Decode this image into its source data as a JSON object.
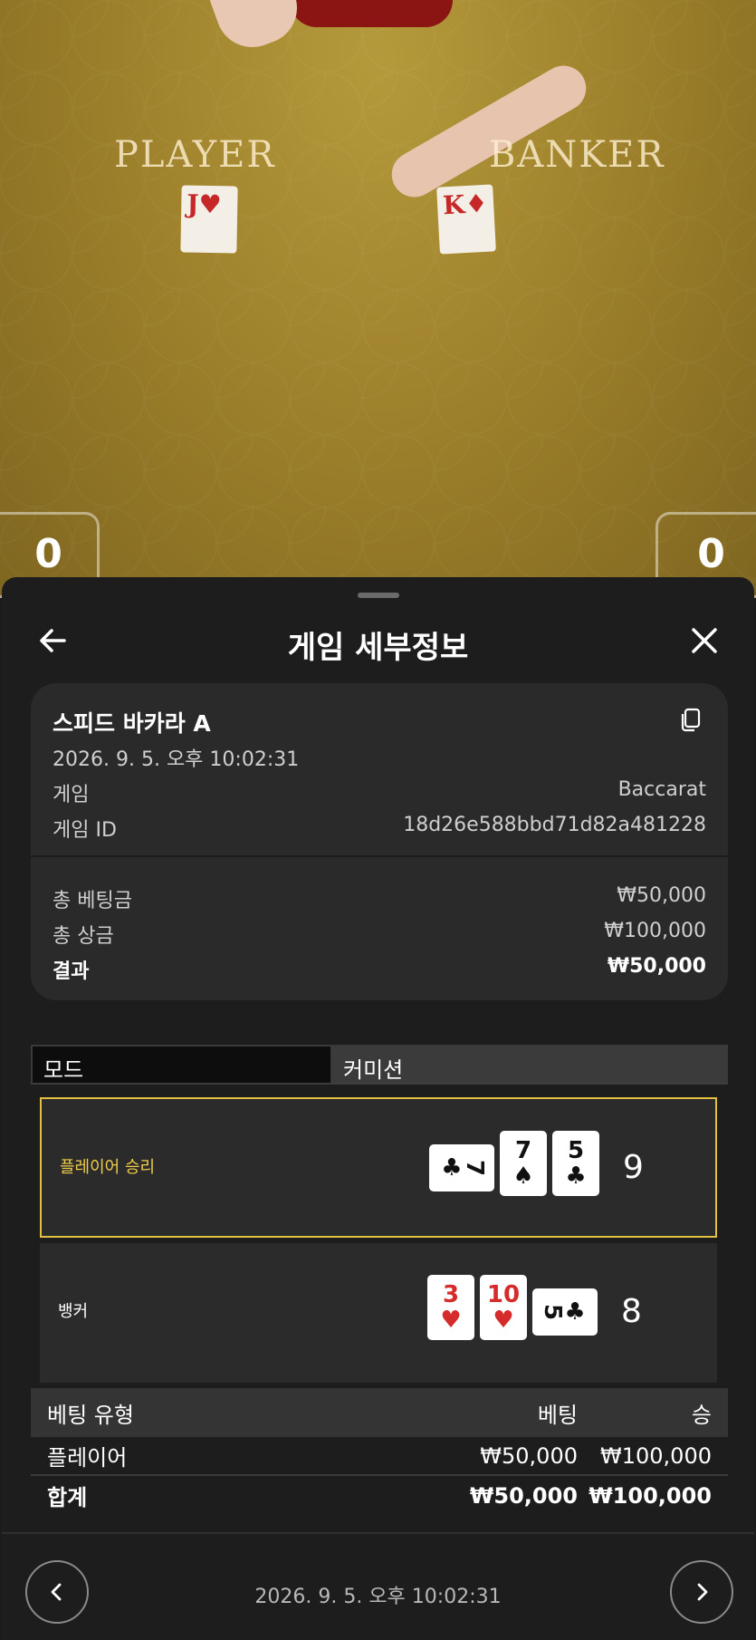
{
  "table_view": {
    "player_label": "PLAYER",
    "banker_label": "BANKER",
    "player_card": "J♥",
    "banker_card": "K♦",
    "player_score": "0",
    "banker_score": "0"
  },
  "header": {
    "title": "게임 세부정보",
    "back_icon": "arrow-left-icon",
    "close_icon": "close-icon"
  },
  "summary": {
    "table_name": "스피드 바카라 A",
    "timestamp": "2026. 9. 5. 오후 10:02:31",
    "game_label": "게임",
    "game_value": "Baccarat",
    "game_id_label": "게임 ID",
    "game_id_value": "18d26e588bbd71d82a481228",
    "total_bet_label": "총 베팅금",
    "total_bet_value": "₩50,000",
    "total_win_label": "총 상금",
    "total_win_value": "₩100,000",
    "result_label": "결과",
    "result_value": "₩50,000"
  },
  "tabs": {
    "mode": "모드",
    "commission": "커미션"
  },
  "hands": {
    "player": {
      "label": "플레이어 승리",
      "cards": [
        {
          "rank": "7",
          "suit": "♣",
          "color": "black",
          "sideways": true
        },
        {
          "rank": "7",
          "suit": "♠",
          "color": "black",
          "sideways": false
        },
        {
          "rank": "5",
          "suit": "♣",
          "color": "black",
          "sideways": false
        }
      ],
      "total": "9"
    },
    "banker": {
      "label": "뱅커",
      "cards": [
        {
          "rank": "3",
          "suit": "♥",
          "color": "red",
          "sideways": false
        },
        {
          "rank": "10",
          "suit": "♥",
          "color": "red",
          "sideways": false
        },
        {
          "rank": "5",
          "suit": "♣",
          "color": "black",
          "sideways": true
        }
      ],
      "total": "8"
    }
  },
  "bets": {
    "headers": {
      "type": "베팅 유형",
      "bet": "베팅",
      "win": "승"
    },
    "rows": [
      {
        "type": "플레이어",
        "bet": "₩50,000",
        "win": "₩100,000"
      }
    ],
    "total": {
      "type": "합계",
      "bet": "₩50,000",
      "win": "₩100,000"
    }
  },
  "footer": {
    "timestamp": "2026. 9. 5. 오후 10:02:31",
    "prev_icon": "chevron-left-icon",
    "next_icon": "chevron-right-icon"
  },
  "colors": {
    "win_border": "#e2c043",
    "win_label": "#f0cd4a",
    "red_suit": "#d62b2b"
  }
}
